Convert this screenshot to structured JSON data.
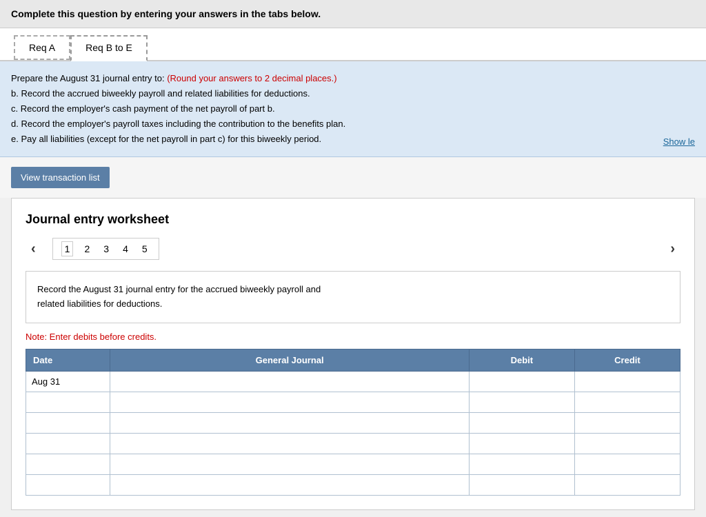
{
  "instruction_bar": {
    "text": "Complete this question by entering your answers in the tabs below."
  },
  "tabs": [
    {
      "label": "Req A",
      "active": false
    },
    {
      "label": "Req B to E",
      "active": true
    }
  ],
  "info_area": {
    "intro": "Prepare the August 31 journal entry to: ",
    "round_note": "(Round your answers to 2 decimal places.)",
    "items": [
      "b. Record the accrued biweekly payroll and related liabilities for deductions.",
      "c. Record the employer's cash payment of the net payroll of part b.",
      "d. Record the employer's payroll taxes including the contribution to the benefits plan.",
      "e. Pay all liabilities (except for the net payroll in part c) for this biweekly period."
    ],
    "show_less_label": "Show le"
  },
  "action_bar": {
    "button_label": "View transaction list"
  },
  "worksheet": {
    "title": "Journal entry worksheet",
    "pages": [
      "1",
      "2",
      "3",
      "4",
      "5"
    ],
    "active_page": "1",
    "description": "Record the August 31 journal entry for the accrued biweekly payroll and\nrelated liabilities for deductions.",
    "note": "Note: Enter debits before credits.",
    "table": {
      "headers": [
        "Date",
        "General Journal",
        "Debit",
        "Credit"
      ],
      "rows": [
        {
          "date": "Aug 31",
          "journal": "",
          "debit": "",
          "credit": ""
        },
        {
          "date": "",
          "journal": "",
          "debit": "",
          "credit": ""
        },
        {
          "date": "",
          "journal": "",
          "debit": "",
          "credit": ""
        },
        {
          "date": "",
          "journal": "",
          "debit": "",
          "credit": ""
        },
        {
          "date": "",
          "journal": "",
          "debit": "",
          "credit": ""
        },
        {
          "date": "",
          "journal": "",
          "debit": "",
          "credit": ""
        }
      ]
    }
  },
  "colors": {
    "header_bg": "#5b7fa6",
    "tab_dashed": "#999",
    "info_bg": "#dbe8f5",
    "red": "#cc0000"
  }
}
